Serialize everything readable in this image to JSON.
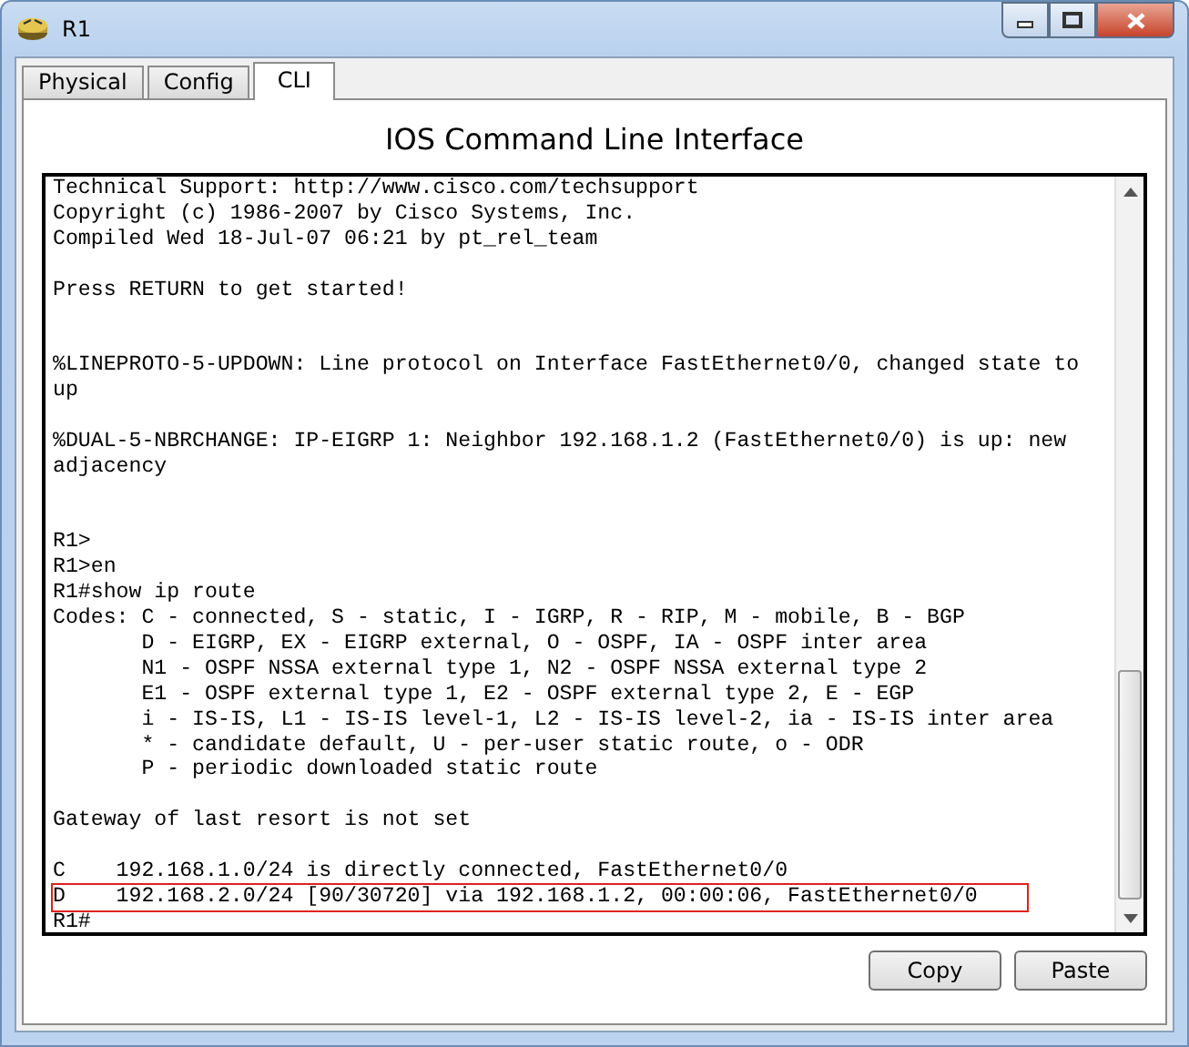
{
  "window": {
    "title": "R1"
  },
  "tabs": [
    {
      "label": "Physical",
      "selected": false
    },
    {
      "label": "Config",
      "selected": false
    },
    {
      "label": "CLI",
      "selected": true
    }
  ],
  "heading": "IOS Command Line Interface",
  "terminal": {
    "lines": [
      {
        "kind": "text",
        "text": "Technical Support: http://www.cisco.com/techsupport",
        "highlighted": false
      },
      {
        "kind": "text",
        "text": "Copyright (c) 1986-2007 by Cisco Systems, Inc.",
        "highlighted": false
      },
      {
        "kind": "text",
        "text": "Compiled Wed 18-Jul-07 06:21 by pt_rel_team",
        "highlighted": false
      },
      {
        "kind": "blank"
      },
      {
        "kind": "text",
        "text": "Press RETURN to get started!",
        "highlighted": false
      },
      {
        "kind": "blank"
      },
      {
        "kind": "blank"
      },
      {
        "kind": "text",
        "text": "%LINEPROTO-5-UPDOWN: Line protocol on Interface FastEthernet0/0, changed state to",
        "highlighted": false
      },
      {
        "kind": "text",
        "text": "up",
        "highlighted": false
      },
      {
        "kind": "blank"
      },
      {
        "kind": "text",
        "text": "%DUAL-5-NBRCHANGE: IP-EIGRP 1: Neighbor 192.168.1.2 (FastEthernet0/0) is up: new",
        "highlighted": false
      },
      {
        "kind": "text",
        "text": "adjacency",
        "highlighted": false
      },
      {
        "kind": "blank"
      },
      {
        "kind": "blank"
      },
      {
        "kind": "text",
        "text": "R1>",
        "highlighted": false
      },
      {
        "kind": "text",
        "text": "R1>en",
        "highlighted": false
      },
      {
        "kind": "text",
        "text": "R1#show ip route",
        "highlighted": false
      },
      {
        "kind": "text",
        "text": "Codes: C - connected, S - static, I - IGRP, R - RIP, M - mobile, B - BGP",
        "highlighted": false
      },
      {
        "kind": "text",
        "text": "       D - EIGRP, EX - EIGRP external, O - OSPF, IA - OSPF inter area",
        "highlighted": false
      },
      {
        "kind": "text",
        "text": "       N1 - OSPF NSSA external type 1, N2 - OSPF NSSA external type 2",
        "highlighted": false
      },
      {
        "kind": "text",
        "text": "       E1 - OSPF external type 1, E2 - OSPF external type 2, E - EGP",
        "highlighted": false
      },
      {
        "kind": "text",
        "text": "       i - IS-IS, L1 - IS-IS level-1, L2 - IS-IS level-2, ia - IS-IS inter area",
        "highlighted": false
      },
      {
        "kind": "text",
        "text": "       * - candidate default, U - per-user static route, o - ODR",
        "highlighted": false
      },
      {
        "kind": "text",
        "text": "       P - periodic downloaded static route",
        "highlighted": false
      },
      {
        "kind": "blank"
      },
      {
        "kind": "text",
        "text": "Gateway of last resort is not set",
        "highlighted": false
      },
      {
        "kind": "blank"
      },
      {
        "kind": "text",
        "text": "C    192.168.1.0/24 is directly connected, FastEthernet0/0",
        "highlighted": false
      },
      {
        "kind": "text",
        "text": "D    192.168.2.0/24 [90/30720] via 192.168.1.2, 00:00:06, FastEthernet0/0",
        "highlighted": true
      },
      {
        "kind": "text",
        "text": "R1#",
        "highlighted": false
      }
    ]
  },
  "buttons": [
    "Copy",
    "Paste"
  ]
}
